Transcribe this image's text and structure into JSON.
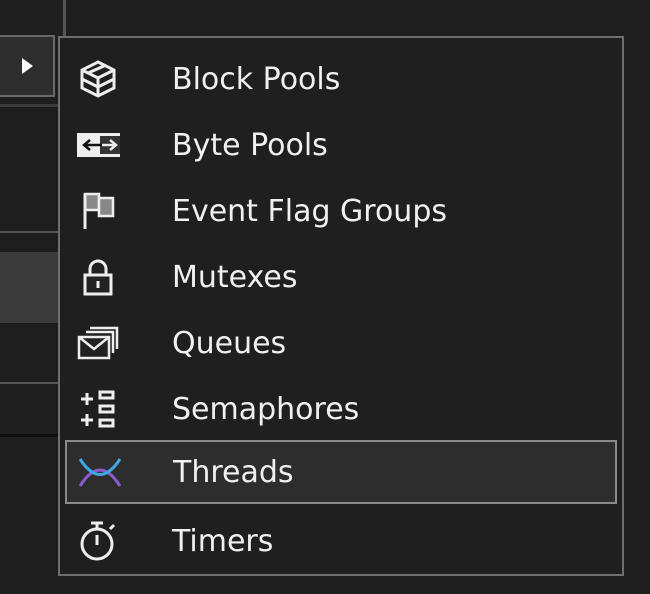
{
  "menu": {
    "items": [
      {
        "label": "Block Pools",
        "icon": "cube-icon"
      },
      {
        "label": "Byte Pools",
        "icon": "swap-arrows-icon"
      },
      {
        "label": "Event Flag Groups",
        "icon": "flag-icon"
      },
      {
        "label": "Mutexes",
        "icon": "lock-icon"
      },
      {
        "label": "Queues",
        "icon": "queue-mail-icon"
      },
      {
        "label": "Semaphores",
        "icon": "semaphore-icon"
      },
      {
        "label": "Threads",
        "icon": "threads-icon",
        "selected": true
      },
      {
        "label": "Timers",
        "icon": "stopwatch-icon"
      }
    ]
  },
  "colors": {
    "accent_blue": "#3fa9e6",
    "accent_purple": "#8a5cd0"
  }
}
